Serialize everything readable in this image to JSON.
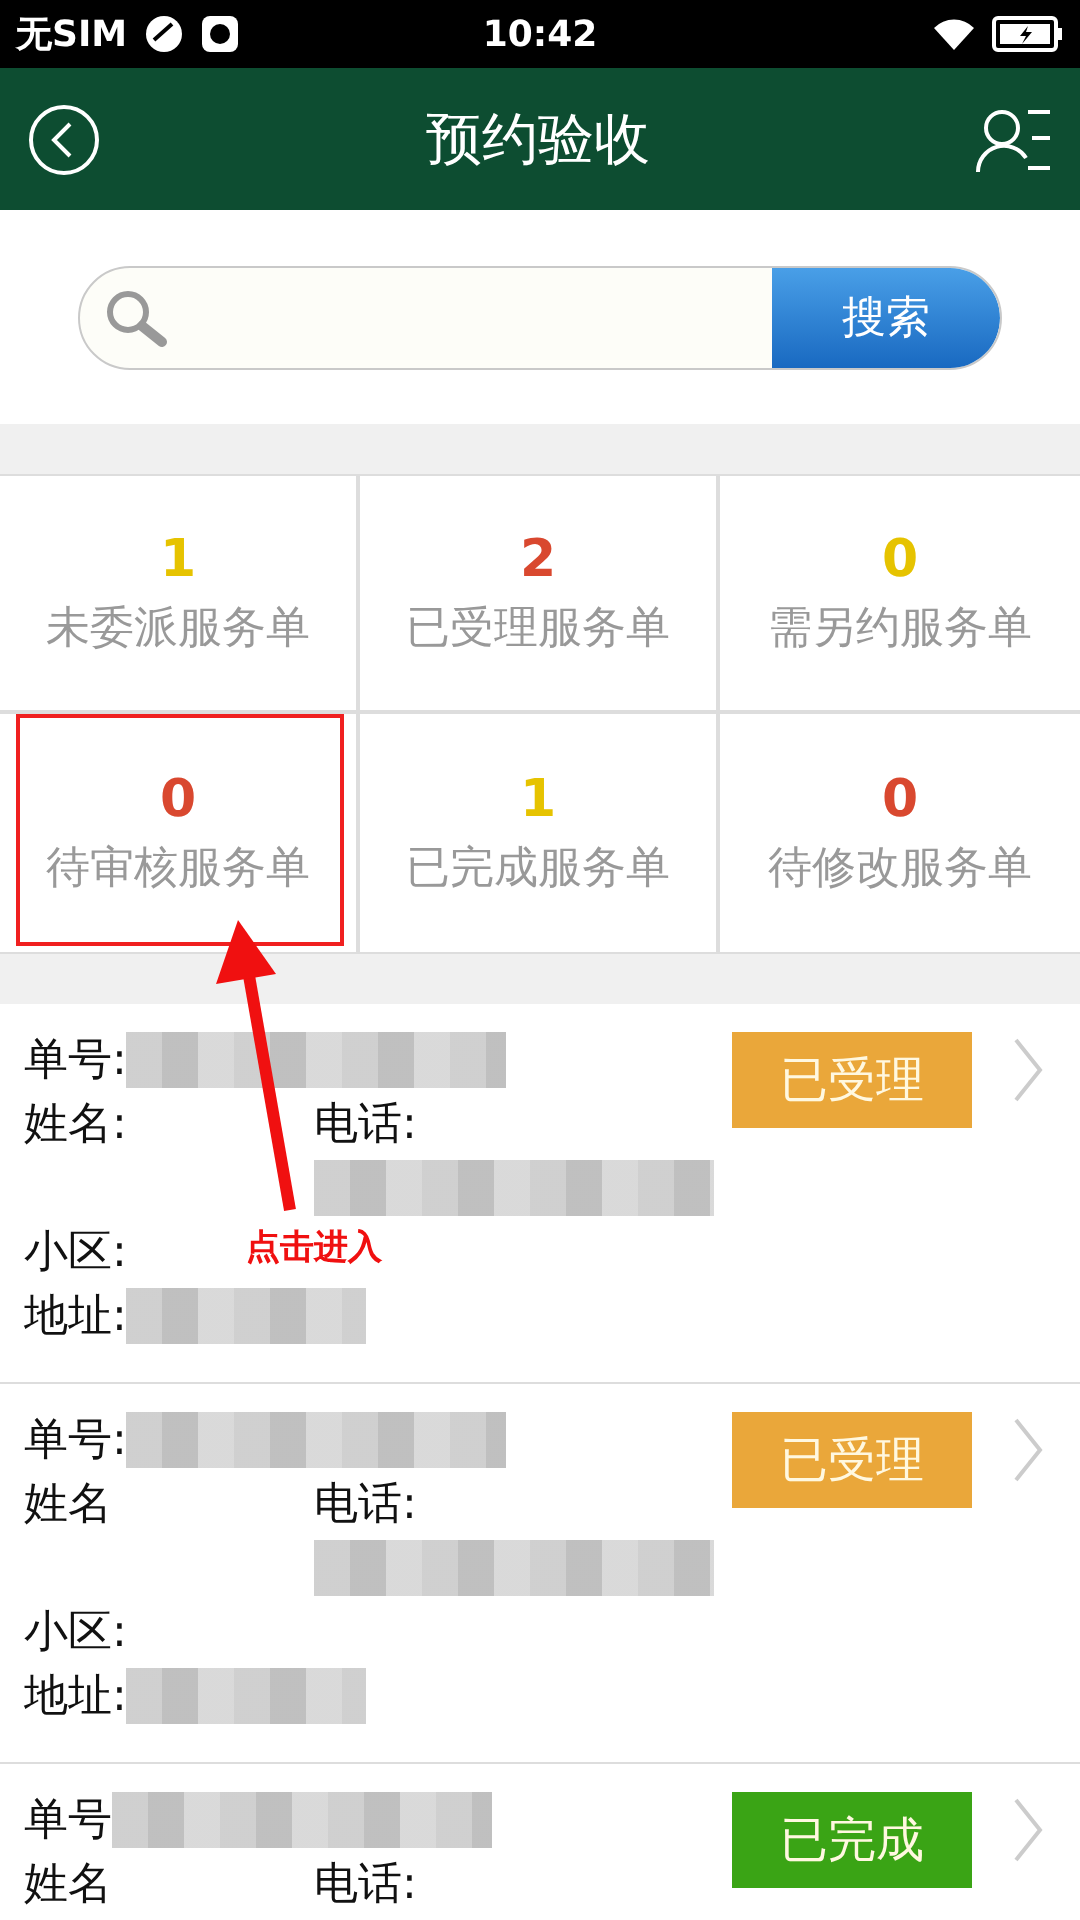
{
  "status_bar": {
    "carrier": "无SIM",
    "time": "10:42"
  },
  "header": {
    "title": "预约验收"
  },
  "search": {
    "button": "搜索"
  },
  "counters": [
    {
      "count": "1",
      "label": "未委派服务单",
      "color": "#e6c300",
      "highlighted": false
    },
    {
      "count": "2",
      "label": "已受理服务单",
      "color": "#d9482f",
      "highlighted": false
    },
    {
      "count": "0",
      "label": "需另约服务单",
      "color": "#e6c300",
      "highlighted": false
    },
    {
      "count": "0",
      "label": "待审核服务单",
      "color": "#d9482f",
      "highlighted": true
    },
    {
      "count": "1",
      "label": "已完成服务单",
      "color": "#e6c300",
      "highlighted": false
    },
    {
      "count": "0",
      "label": "待修改服务单",
      "color": "#d9482f",
      "highlighted": false
    }
  ],
  "annotation": {
    "text": "点击进入"
  },
  "orders": [
    {
      "order_label": "单号:",
      "name_label": "姓名:",
      "phone_label": "电话:",
      "district_label": "小区:",
      "address_label": "地址:",
      "status": "已受理",
      "color": "#eaa73a"
    },
    {
      "order_label": "单号:",
      "name_label": "姓名",
      "phone_label": "电话:",
      "district_label": "小区:",
      "address_label": "地址:",
      "status": "已受理",
      "color": "#eaa73a"
    },
    {
      "order_label": "单号",
      "name_label": "姓名",
      "phone_label": "电话:",
      "status": "已完成",
      "color": "#3aa415"
    }
  ]
}
